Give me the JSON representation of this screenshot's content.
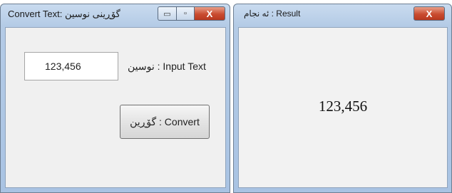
{
  "convert_window": {
    "title": "Convert Text: گۆڕینی نوسین",
    "input_value": "123,456",
    "input_label": "نوسین : Input Text",
    "convert_label": "گۆڕین : Convert"
  },
  "result_window": {
    "title": "ئه نجام : Result",
    "result_value": "123,456"
  },
  "controls": {
    "minimize": "▭",
    "maximize": "▫",
    "close": "X"
  }
}
